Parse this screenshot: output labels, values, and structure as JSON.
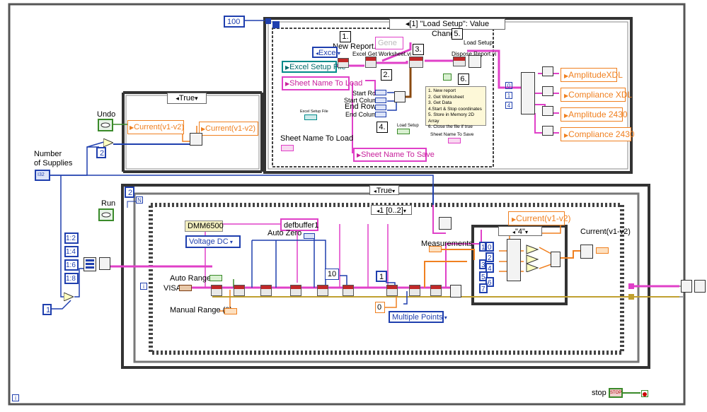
{
  "constants": {
    "top_100": "100",
    "two_top": "2",
    "two_loop": "2",
    "one_bottom": "1",
    "ten": "10",
    "one_mid": "1",
    "zero": "0",
    "ratios": [
      "1:2",
      "1:4",
      "1:6",
      "1:8"
    ]
  },
  "labels": {
    "undo": "Undo",
    "run": "Run",
    "number_of_supplies": "Number\nof Supplies",
    "measurements": "Measurements",
    "current_out": "Current(v1-v2)",
    "stop": "stop",
    "auto_range": "Auto Range",
    "visa": "VISA",
    "manual_range": "Manual Range (0)",
    "auto_zero": "Auto Zero",
    "sheet_name_to_load_lbl": "Sheet Name To Load",
    "start_row": "Start Row",
    "start_column": "Start Column",
    "end_row": "End Row",
    "end_column": "End Column",
    "new_report": "New Report.vi",
    "get_worksheet": "Excel Get Worksheet.vi",
    "dispose_report": "Dispose Report.vi",
    "load_setup_small": "Load Setup",
    "load_setup_bool": "Load Setup",
    "excel_setup_file_small": "Excel Setup File",
    "sheet_name_to_save_small": "Sheet Name To Save",
    "sheet_name_to_load": "Sheet Name To Load"
  },
  "structures": {
    "case_true_top": "True",
    "event_case": "[1] \"Load Setup\": Value Change",
    "case_true_main": "True",
    "sequence": "1 [0..2]",
    "case_four": "\"4\"",
    "loop_iter": "i",
    "loop_n": "N"
  },
  "steps": [
    "1.",
    "2.",
    "3.",
    "4.",
    "5.",
    "6."
  ],
  "comment_lines": [
    "1. New report",
    "2. Get Worksheet",
    "3. Get Data",
    "4.Start & Stop coordinates",
    "5. Store in Memory 2D Array",
    "6. Close the file if true"
  ],
  "controls": {
    "excel_enum": "Excel",
    "excel_setup_file": "Excel Setup File",
    "sheet_name_to_load": "Sheet Name To Load",
    "sheet_name_to_save": "Sheet Name To Save",
    "gene": "Gene",
    "current_a": "Current(v1-v2)",
    "current_b": "Current(v1-v2)",
    "current_case": "Current(v1-v2)",
    "dmm": "DMM6500",
    "voltage_dc": "Voltage DC",
    "defbuffer": "defbuffer1",
    "multiple_points": "Multiple Points",
    "amplitude_xdl": "AmplitudeXDL",
    "compliance_xdl": "Compliance  XDL",
    "amplitude_2430": "Amplitude 2430",
    "compliance_2430": "Compliance 2430"
  },
  "numeric_indices": [
    "0",
    "1",
    "2",
    "3",
    "4",
    "5",
    "6",
    "7"
  ],
  "colors": {
    "wire_pink": "#e040c8",
    "wire_blue": "#1f3fae",
    "wire_orange": "#f08020",
    "wire_brown": "#8a4a10",
    "wire_green": "#3a8a2a",
    "wire_teal": "#008a8a"
  }
}
